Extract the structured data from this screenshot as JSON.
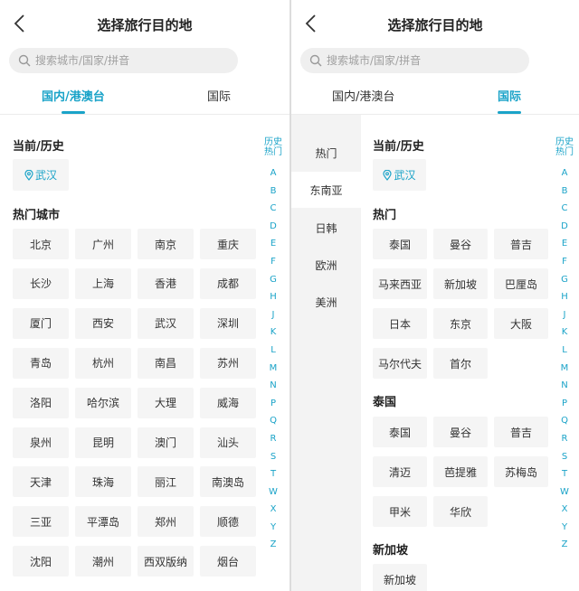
{
  "left": {
    "title": "选择旅行目的地",
    "search_placeholder": "搜索城市/国家/拼音",
    "tabs": [
      "国内/港澳台",
      "国际"
    ],
    "current_section": "当前/历史",
    "current_city": "武汉",
    "hot_section": "热门城市",
    "hot_cities": [
      [
        "北京",
        "广州",
        "南京",
        "重庆"
      ],
      [
        "长沙",
        "上海",
        "香港",
        "成都"
      ],
      [
        "厦门",
        "西安",
        "武汉",
        "深圳"
      ],
      [
        "青岛",
        "杭州",
        "南昌",
        "苏州"
      ],
      [
        "洛阳",
        "哈尔滨",
        "大理",
        "威海"
      ],
      [
        "泉州",
        "昆明",
        "澳门",
        "汕头"
      ],
      [
        "天津",
        "珠海",
        "丽江",
        "南澳岛"
      ],
      [
        "三亚",
        "平潭岛",
        "郑州",
        "顺德"
      ],
      [
        "沈阳",
        "潮州",
        "西双版纳",
        "烟台"
      ]
    ],
    "index_history": "历史",
    "index_hot": "热门"
  },
  "right": {
    "title": "选择旅行目的地",
    "search_placeholder": "搜索城市/国家/拼音",
    "tabs": [
      "国内/港澳台",
      "国际"
    ],
    "sidebar": [
      "热门",
      "东南亚",
      "日韩",
      "欧洲",
      "美洲"
    ],
    "current_section": "当前/历史",
    "current_city": "武汉",
    "hot_section": "热门",
    "hot_items": [
      [
        "泰国",
        "曼谷",
        "普吉"
      ],
      [
        "马来西亚",
        "新加坡",
        "巴厘岛"
      ],
      [
        "日本",
        "东京",
        "大阪"
      ],
      [
        "马尔代夫",
        "首尔"
      ]
    ],
    "thailand_section": "泰国",
    "thailand_items": [
      [
        "泰国",
        "曼谷",
        "普吉"
      ],
      [
        "清迈",
        "芭提雅",
        "苏梅岛"
      ],
      [
        "甲米",
        "华欣"
      ]
    ],
    "singapore_section": "新加坡",
    "singapore_items": [
      "新加坡"
    ],
    "index_history": "历史",
    "index_hot": "热门"
  },
  "index_letters": [
    "A",
    "B",
    "C",
    "D",
    "E",
    "F",
    "G",
    "H",
    "J",
    "K",
    "L",
    "M",
    "N",
    "P",
    "Q",
    "R",
    "S",
    "T",
    "W",
    "X",
    "Y",
    "Z"
  ],
  "colors": {
    "accent": "#1aa3c8",
    "chip_bg": "#f5f5f5",
    "sidebar_bg": "#f3f3f3"
  }
}
